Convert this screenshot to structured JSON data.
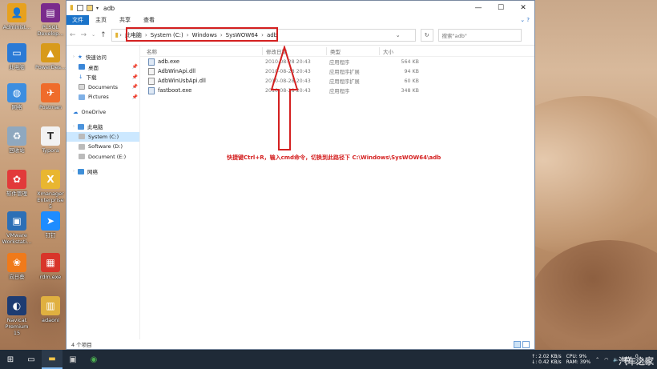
{
  "desktop": {
    "icons": [
      {
        "label": "Administ...",
        "color": "#e7a11e",
        "glyph": "👤"
      },
      {
        "label": "PLSQL Develop...",
        "color": "#7a2b8c",
        "glyph": "▤"
      },
      {
        "label": "此电脑",
        "color": "#2a7ad6",
        "glyph": "▭"
      },
      {
        "label": "PowerDes...",
        "color": "#d89a1a",
        "glyph": "▲"
      },
      {
        "label": "网络",
        "color": "#3d8ee0",
        "glyph": "◍"
      },
      {
        "label": "Postman",
        "color": "#ef6c2b",
        "glyph": "✈"
      },
      {
        "label": "回收站",
        "color": "#8fa8bf",
        "glyph": "♻"
      },
      {
        "label": "Typora",
        "color": "#f2f2f2",
        "glyph": "T"
      },
      {
        "label": "软件管理",
        "color": "#e23a3a",
        "glyph": "✿"
      },
      {
        "label": "Xmanager Enterprise 5",
        "color": "#e9b630",
        "glyph": "X"
      },
      {
        "label": "VMware Workstati...",
        "color": "#2c6fb6",
        "glyph": "▣"
      },
      {
        "label": "钉钉",
        "color": "#1e8cff",
        "glyph": "➤"
      },
      {
        "label": "向日葵",
        "color": "#f07a1a",
        "glyph": "❀"
      },
      {
        "label": "rdm.exe",
        "color": "#d8352a",
        "glyph": "▦"
      },
      {
        "label": "Navicat Premium 15",
        "color": "#1e3c72",
        "glyph": "◐"
      },
      {
        "label": "adaoni",
        "color": "#e0b040",
        "glyph": "▥"
      }
    ]
  },
  "window": {
    "title": "adb",
    "controls": {
      "minimize": "—",
      "maximize": "☐",
      "close": "✕"
    },
    "ribbon": {
      "file": "文件",
      "tabs": [
        "主页",
        "共享",
        "查看"
      ],
      "expand": "⌄ ?"
    },
    "address": {
      "crumbs": [
        "此电脑",
        "System (C:)",
        "Windows",
        "SysWOW64",
        "adb"
      ],
      "search_placeholder": "搜索\"adb\""
    },
    "navpane": {
      "quick_access": "快速访问",
      "quick_items": [
        "桌面",
        "下载",
        "Documents",
        "Pictures"
      ],
      "onedrive": "OneDrive",
      "this_pc": "此电脑",
      "drives": [
        "System (C:)",
        "Software (D:)",
        "Document (E:)"
      ],
      "network": "网络"
    },
    "columns": {
      "name": "名称",
      "date": "修改日期",
      "type": "类型",
      "size": "大小"
    },
    "files": [
      {
        "name": "adb.exe",
        "date": "2010-08-28 20:43",
        "type": "应用程序",
        "size": "564 KB",
        "kind": "exe"
      },
      {
        "name": "AdbWinApi.dll",
        "date": "2010-08-28 20:43",
        "type": "应用程序扩展",
        "size": "94 KB",
        "kind": "dll"
      },
      {
        "name": "AdbWinUsbApi.dll",
        "date": "2010-08-28 20:43",
        "type": "应用程序扩展",
        "size": "60 KB",
        "kind": "dll"
      },
      {
        "name": "fastboot.exe",
        "date": "2010-08-28 20:43",
        "type": "应用程序",
        "size": "348 KB",
        "kind": "exe"
      }
    ],
    "annotation": "快捷键Ctrl+R，输入cmd命令，切换到此路径下 C:\\Windows\\SysWOW64\\adb",
    "status": "4 个项目"
  },
  "taskbar": {
    "net_up": "↑: 2.02 KB/s",
    "net_down": "↓: 0.42 KB/s",
    "cpu": "CPU: 9%",
    "ram": "RAM: 39%",
    "ime": "英",
    "clock_time": "0...",
    "clock_date": "2020-..."
  },
  "watermark": "汽车之家"
}
